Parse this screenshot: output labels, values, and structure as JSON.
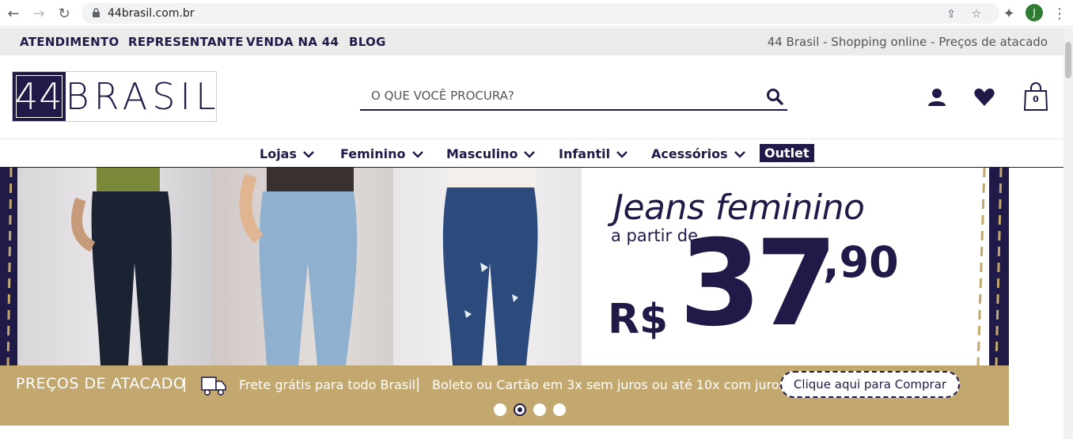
{
  "browser": {
    "url": "44brasil.com.br",
    "avatar_initial": "J"
  },
  "util_bar": {
    "links": [
      "ATENDIMENTO",
      "REPRESENTANTE",
      "VENDA NA 44",
      "BLOG"
    ],
    "tagline": "44 Brasil - Shopping online - Preços de atacado"
  },
  "header": {
    "logo_number": "44",
    "logo_word": "BRASIL",
    "search_placeholder": "O QUE VOCÊ PROCURA?",
    "cart_count": "0"
  },
  "categories": [
    {
      "label": "Lojas"
    },
    {
      "label": "Feminino"
    },
    {
      "label": "Masculino"
    },
    {
      "label": "Infantil"
    },
    {
      "label": "Acessórios"
    }
  ],
  "outlet_label": "Outlet",
  "banner": {
    "title": "Jeans feminino",
    "subtitle": "a partir de",
    "currency": "R$",
    "price_int": "37",
    "price_dec": ",90",
    "strip_1": "PREÇOS DE ATACADO",
    "sep": "|",
    "strip_2": "Frete grátis para todo Brasil",
    "strip_3": "Boleto ou Cartão em 3x sem juros ou até 10x com juros",
    "cta": "Clique aqui para Comprar",
    "slides_total": 4,
    "slide_active": 2
  },
  "colors": {
    "brand_navy": "#1f1a47",
    "gold": "#c2a86e",
    "util_bg": "#ebebeb"
  }
}
